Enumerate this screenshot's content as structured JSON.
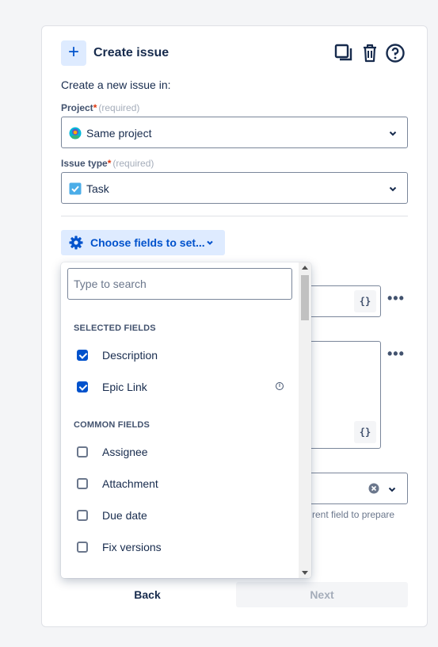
{
  "header": {
    "title": "Create issue",
    "plus_icon": "+",
    "icons": [
      "copy-icon",
      "trash-icon",
      "help-icon"
    ]
  },
  "lead_text": "Create a new issue in:",
  "project": {
    "label": "Project",
    "required_mark": "*",
    "required_text": "(required)",
    "value": "Same project"
  },
  "issue_type": {
    "label": "Issue type",
    "required_mark": "*",
    "required_text": "(required)",
    "value": "Task"
  },
  "choose_fields": {
    "label": "Choose fields to set..."
  },
  "dropdown": {
    "search_placeholder": "Type to search",
    "selected_header": "SELECTED FIELDS",
    "selected": [
      {
        "label": "Description",
        "checked": true
      },
      {
        "label": "Epic Link",
        "checked": true
      }
    ],
    "common_header": "COMMON FIELDS",
    "common": [
      {
        "label": "Assignee",
        "checked": false
      },
      {
        "label": "Attachment",
        "checked": false
      },
      {
        "label": "Due date",
        "checked": false
      },
      {
        "label": "Fix versions",
        "checked": false
      }
    ]
  },
  "background": {
    "brace_label": "{}",
    "more_label": "•••",
    "hint_text": "rent field to prepare"
  },
  "footer": {
    "back_label": "Back",
    "next_label": "Next"
  },
  "colors": {
    "accent": "#0052cc",
    "accent_bg": "#deebff",
    "required": "#de350b"
  }
}
